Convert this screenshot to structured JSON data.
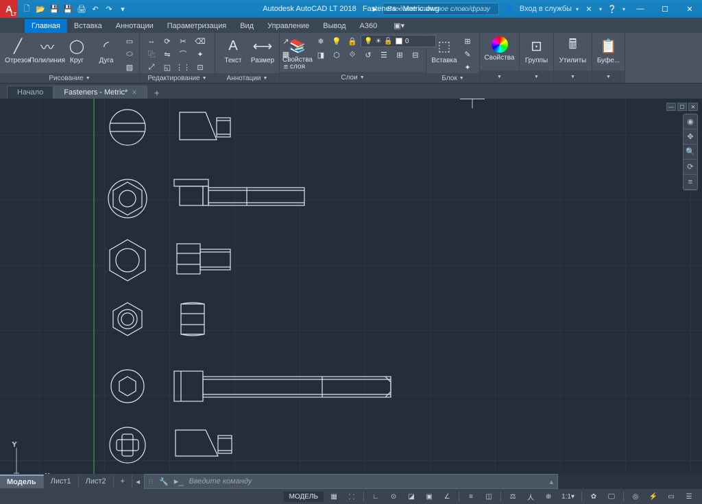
{
  "title": {
    "app": "Autodesk AutoCAD LT 2018",
    "file": "Fasteners - Metric.dwg"
  },
  "search": {
    "placeholder": "Введите ключевое слово/фразу",
    "login": "Вход в службы"
  },
  "tabs": [
    "Главная",
    "Вставка",
    "Аннотации",
    "Параметризация",
    "Вид",
    "Управление",
    "Вывод",
    "A360"
  ],
  "active_tab": 0,
  "ribbon": {
    "draw": {
      "label": "Рисование",
      "line": "Отрезок",
      "polyline": "Полилиния",
      "circle": "Круг",
      "arc": "Дуга"
    },
    "edit": {
      "label": "Редактирование"
    },
    "annot": {
      "label": "Аннотации",
      "text": "Текст",
      "dim": "Размер"
    },
    "layers": {
      "label": "Слои",
      "props": "Свойства слоя",
      "current": "0"
    },
    "block": {
      "label": "Блок",
      "insert": "Вставка"
    },
    "props": {
      "label": "Свойства"
    },
    "groups": {
      "label": "Группы"
    },
    "util": {
      "label": "Утилиты"
    },
    "clip": {
      "label": "Буфе..."
    }
  },
  "doctabs": {
    "home": "Начало",
    "file": "Fasteners - Metric*"
  },
  "layout": {
    "model": "Модель",
    "sheet1": "Лист1",
    "sheet2": "Лист2"
  },
  "cmd": {
    "placeholder": "Введите команду"
  },
  "status": {
    "model": "МОДЕЛЬ",
    "scale": "1:1"
  }
}
